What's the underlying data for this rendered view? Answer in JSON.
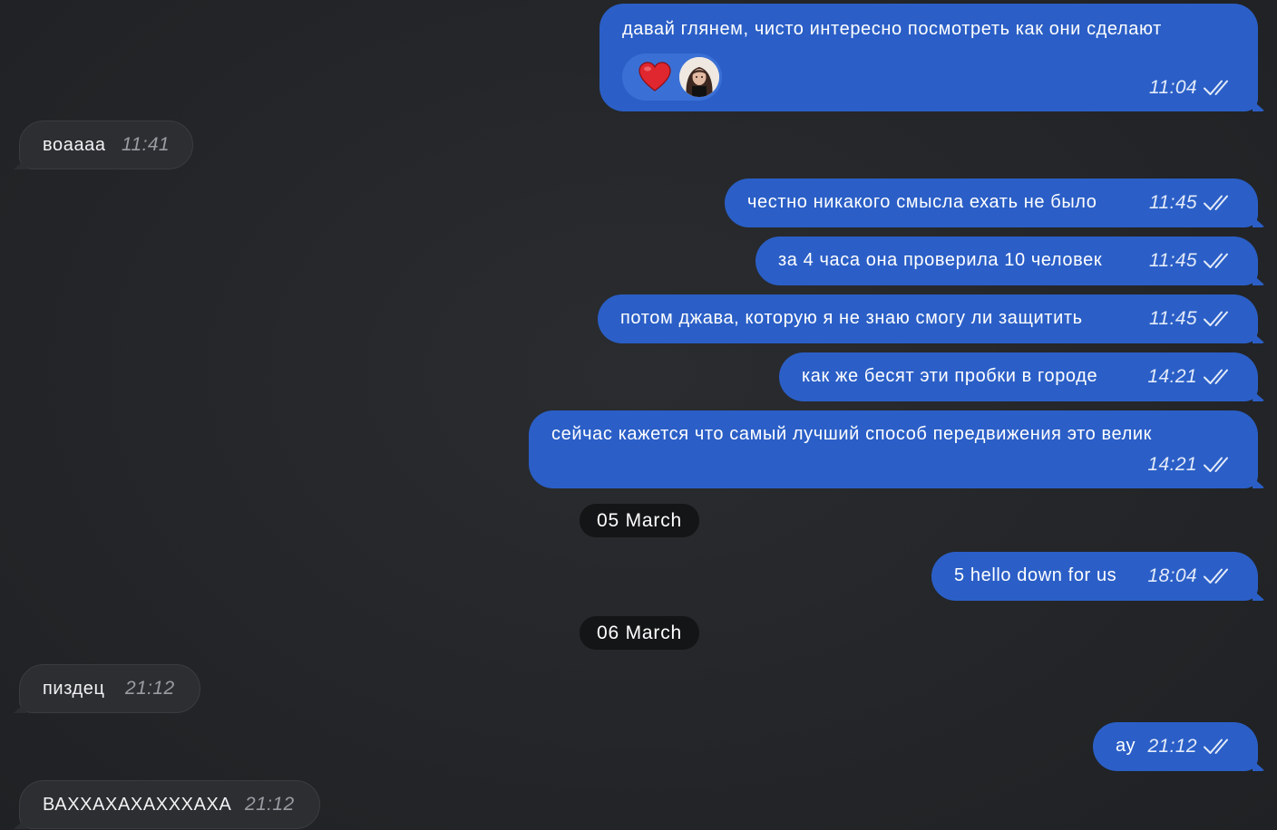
{
  "messages": [
    {
      "text": "давай глянем, чисто интересно посмотреть как они сделают",
      "time": "11:04",
      "direction": "out",
      "status": "read",
      "reactions": [
        "heart-icon",
        "avatar"
      ]
    },
    {
      "text": "воаааа",
      "time": "11:41",
      "direction": "in"
    },
    {
      "text": "честно никакого смысла ехать не было",
      "time": "11:45",
      "direction": "out",
      "status": "read"
    },
    {
      "text": "за 4 часа она проверила 10 человек",
      "time": "11:45",
      "direction": "out",
      "status": "read"
    },
    {
      "text": "потом джава, которую я не знаю смогу ли защитить",
      "time": "11:45",
      "direction": "out",
      "status": "read"
    },
    {
      "text": "как же бесят эти пробки в городе",
      "time": "14:21",
      "direction": "out",
      "status": "read"
    },
    {
      "text": "сейчас кажется что самый лучший способ передвижения это велик",
      "time": "14:21",
      "direction": "out",
      "status": "read"
    },
    {
      "text": "5 hello down for us",
      "time": "18:04",
      "direction": "out",
      "status": "read"
    },
    {
      "text": "пиздец",
      "time": "21:12",
      "direction": "in"
    },
    {
      "text": "ау",
      "time": "21:12",
      "direction": "out",
      "status": "read"
    },
    {
      "text": "ВАХХАХАХАХХХАХА",
      "time": "21:12",
      "direction": "in"
    }
  ],
  "dates": [
    "05 March",
    "06 March"
  ],
  "colors": {
    "background": "#25272a",
    "outgoing_bubble": "#2b5fc7",
    "incoming_bubble": "#2c2e32",
    "date_pill": "#141516",
    "reaction_chip": "#3a70d6"
  }
}
